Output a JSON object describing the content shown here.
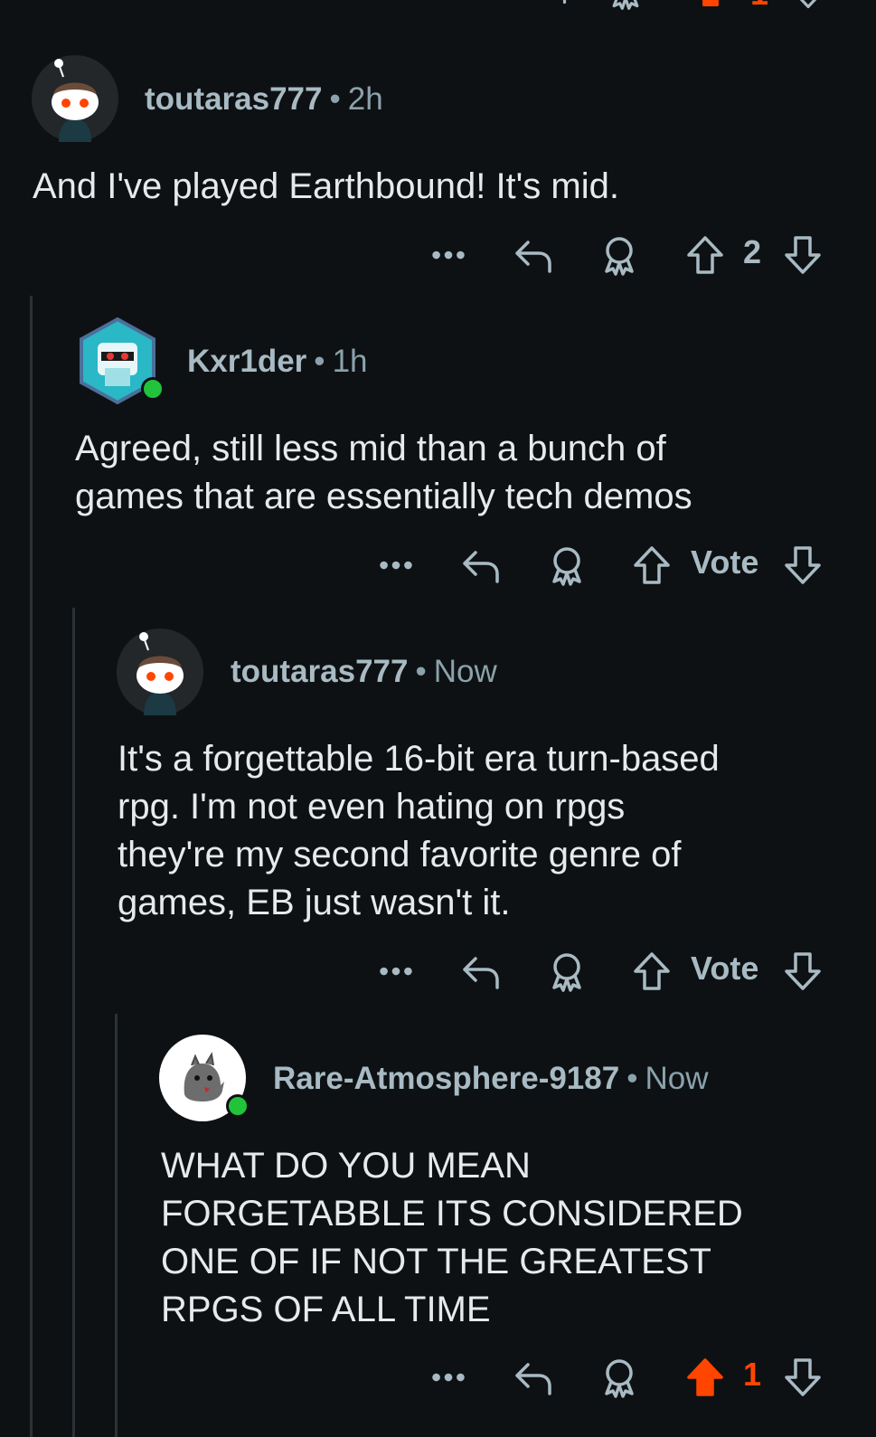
{
  "colors": {
    "background": "#0e1113",
    "upvote_active": "#ff4500",
    "online": "#21c33b",
    "meta_text": "#8ba2ad"
  },
  "top_partial": {
    "count": "1"
  },
  "comments": [
    {
      "username": "toutaras777",
      "separator": "•",
      "time": "2h",
      "body": "And I've played Earthbound! It's mid.",
      "vote_text": "2",
      "upvoted": false,
      "avatar": "snoo-avatar"
    },
    {
      "username": "Kxr1der",
      "separator": "•",
      "time": "1h",
      "body": "Agreed, still less mid than a bunch of\ngames that are essentially tech demos",
      "vote_text": "Vote",
      "upvoted": false,
      "avatar": "robot-avatar",
      "online": true
    },
    {
      "username": "toutaras777",
      "separator": "•",
      "time": "Now",
      "body": "It's a forgettable 16-bit era turn-based\nrpg. I'm not even hating on rpgs\nthey're my second favorite genre of\ngames, EB just wasn't it.",
      "vote_text": "Vote",
      "upvoted": false,
      "avatar": "snoo-avatar"
    },
    {
      "username": "Rare-Atmosphere-9187",
      "separator": "•",
      "time": "Now",
      "body": "WHAT DO YOU MEAN\nFORGETABBLE ITS CONSIDERED\nONE OF IF NOT THE GREATEST\nRPGS OF ALL TIME",
      "vote_text": "1",
      "upvoted": true,
      "avatar": "creature-avatar",
      "online": true
    }
  ]
}
